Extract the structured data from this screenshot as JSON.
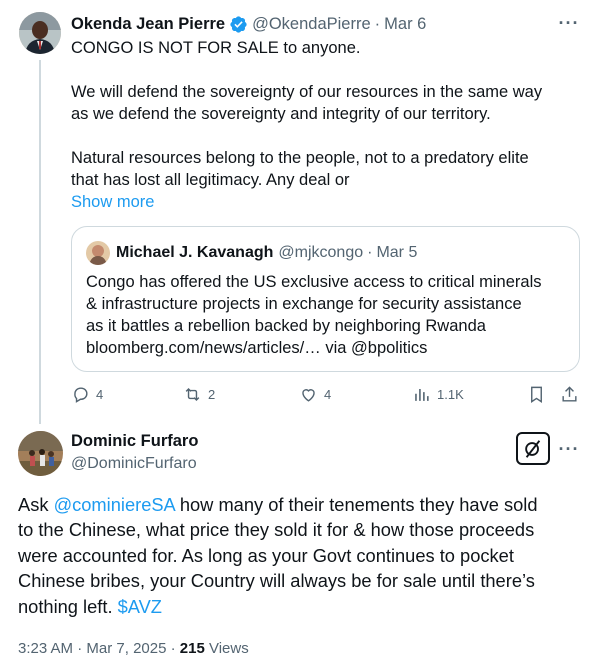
{
  "colors": {
    "link": "#1d9bf0",
    "muted": "#536471",
    "text": "#0f1419",
    "verified": "#1d9bf0",
    "border": "#cfd9de"
  },
  "tweet": {
    "author_name": "Okenda Jean Pierre",
    "handle": "@OkendaPierre",
    "separator": "·",
    "date": "Mar 6",
    "more_icon": "more-horizontal-icon",
    "lines": [
      "CONGO IS NOT FOR SALE to anyone.",
      "We will defend the sovereignty of our resources in the same way",
      "as we defend the sovereignty and integrity of our territory.",
      "Natural resources belong to the people, not to a predatory elite",
      "that has lost all legitimacy. Any deal or"
    ],
    "show_more": "Show more",
    "quote": {
      "author_name": "Michael J. Kavanagh",
      "handle": "@mjkcongo",
      "separator": "·",
      "date": "Mar 5",
      "lines": [
        "Congo has offered the US exclusive access to critical minerals",
        "& infrastructure projects in exchange for security assistance",
        "as it battles a rebellion backed by neighboring Rwanda",
        "bloomberg.com/news/articles/… via @bpolitics"
      ]
    },
    "actions": {
      "replies": "4",
      "reposts": "2",
      "likes": "4",
      "views": "1.1K"
    }
  },
  "reply": {
    "author_name": "Dominic Furfaro",
    "handle": "@DominicFurfaro",
    "lines": [
      {
        "pre": "Ask ",
        "mention": "@cominiereSA",
        "post": " how many of their tenements they have sold"
      },
      {
        "pre": "to the Chinese, what price they sold it for & how those proceeds"
      },
      {
        "pre": "were accounted for.  As long as your Govt continues to pocket"
      },
      {
        "pre": "Chinese bribes, your Country will always be for sale until there’s"
      },
      {
        "pre": "nothing left. ",
        "mention": "$AVZ"
      }
    ],
    "time": "3:23 AM",
    "separator": "·",
    "date": "Mar 7, 2025",
    "separator2": "·",
    "views_count": "215",
    "views_label": "Views"
  }
}
